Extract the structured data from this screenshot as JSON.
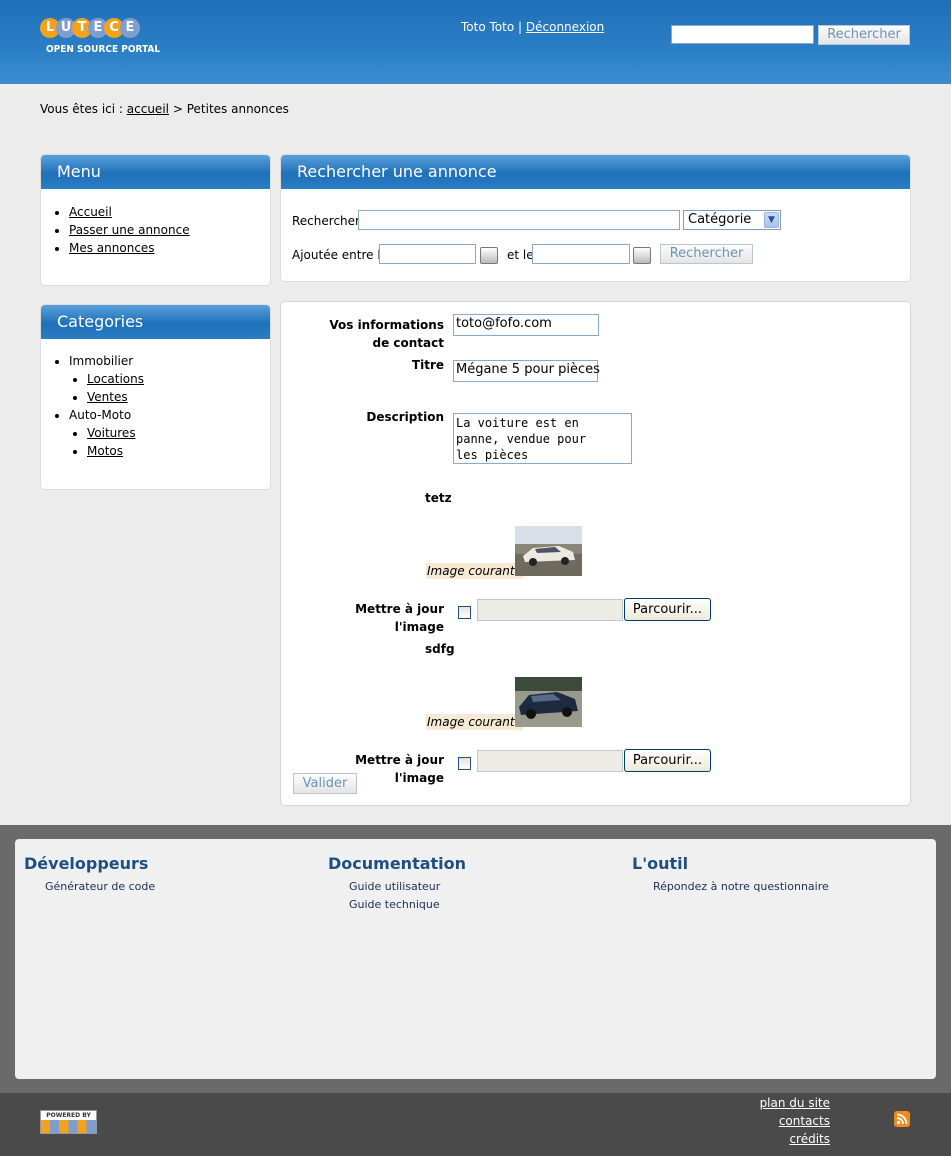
{
  "header": {
    "logo_letters": [
      "L",
      "U",
      "T",
      "E",
      "C",
      "E"
    ],
    "logo_subtitle": "OPEN SOURCE PORTAL",
    "user_name": "Toto Toto",
    "separator": "|",
    "logout_label": "Déconnexion",
    "search_value": "",
    "search_button": "Rechercher"
  },
  "breadcrumb": {
    "prefix": "Vous êtes ici :",
    "home": "accueil",
    "sep": ">",
    "current": "Petites annonces"
  },
  "menu": {
    "title": "Menu",
    "items": [
      "Accueil",
      "Passer une annonce",
      "Mes annonces"
    ]
  },
  "categories": {
    "title": "Categories",
    "groups": [
      {
        "name": "Immobilier",
        "items": [
          "Locations",
          "Ventes"
        ]
      },
      {
        "name": "Auto-Moto",
        "items": [
          "Voitures",
          "Motos"
        ]
      }
    ]
  },
  "search": {
    "title": "Rechercher une annonce",
    "query_label": "Rechercher",
    "query_value": "",
    "category_selected": "Catégorie",
    "date_label": "Ajoutée entre le",
    "date_and": "et le",
    "date_from": "",
    "date_to": "",
    "submit": "Rechercher"
  },
  "form": {
    "contact_label": "Vos informations de contact",
    "contact_value": "toto@fofo.com",
    "title_label": "Titre",
    "title_value": "Mégane 5 pour pièces",
    "description_label": "Description",
    "description_value": "La voiture est en\npanne, vendue pour\nles pièces",
    "images": [
      {
        "name": "tetz",
        "current_label": "Image courante",
        "update_label": "Mettre à jour l'image",
        "browse": "Parcourir..."
      },
      {
        "name": "sdfg",
        "current_label": "Image courante",
        "update_label": "Mettre à jour l'image",
        "browse": "Parcourir..."
      }
    ],
    "submit": "Valider"
  },
  "footer": {
    "columns": [
      {
        "title": "Développeurs",
        "links": [
          "Générateur de code"
        ]
      },
      {
        "title": "Documentation",
        "links": [
          "Guide utilisateur",
          "Guide technique"
        ]
      },
      {
        "title": "L'outil",
        "links": [
          "Répondez à notre questionnaire"
        ]
      }
    ],
    "powered_by": "POWERED BY",
    "bottom_links": [
      "plan du site",
      "contacts",
      "crédits"
    ]
  },
  "colors": {
    "header_blue": "#2b7fc6",
    "box_title_blue": "#1e70b8",
    "button_text": "#6b93b8",
    "footer_title": "#1f4e85",
    "rss_orange": "#f08a1e"
  }
}
